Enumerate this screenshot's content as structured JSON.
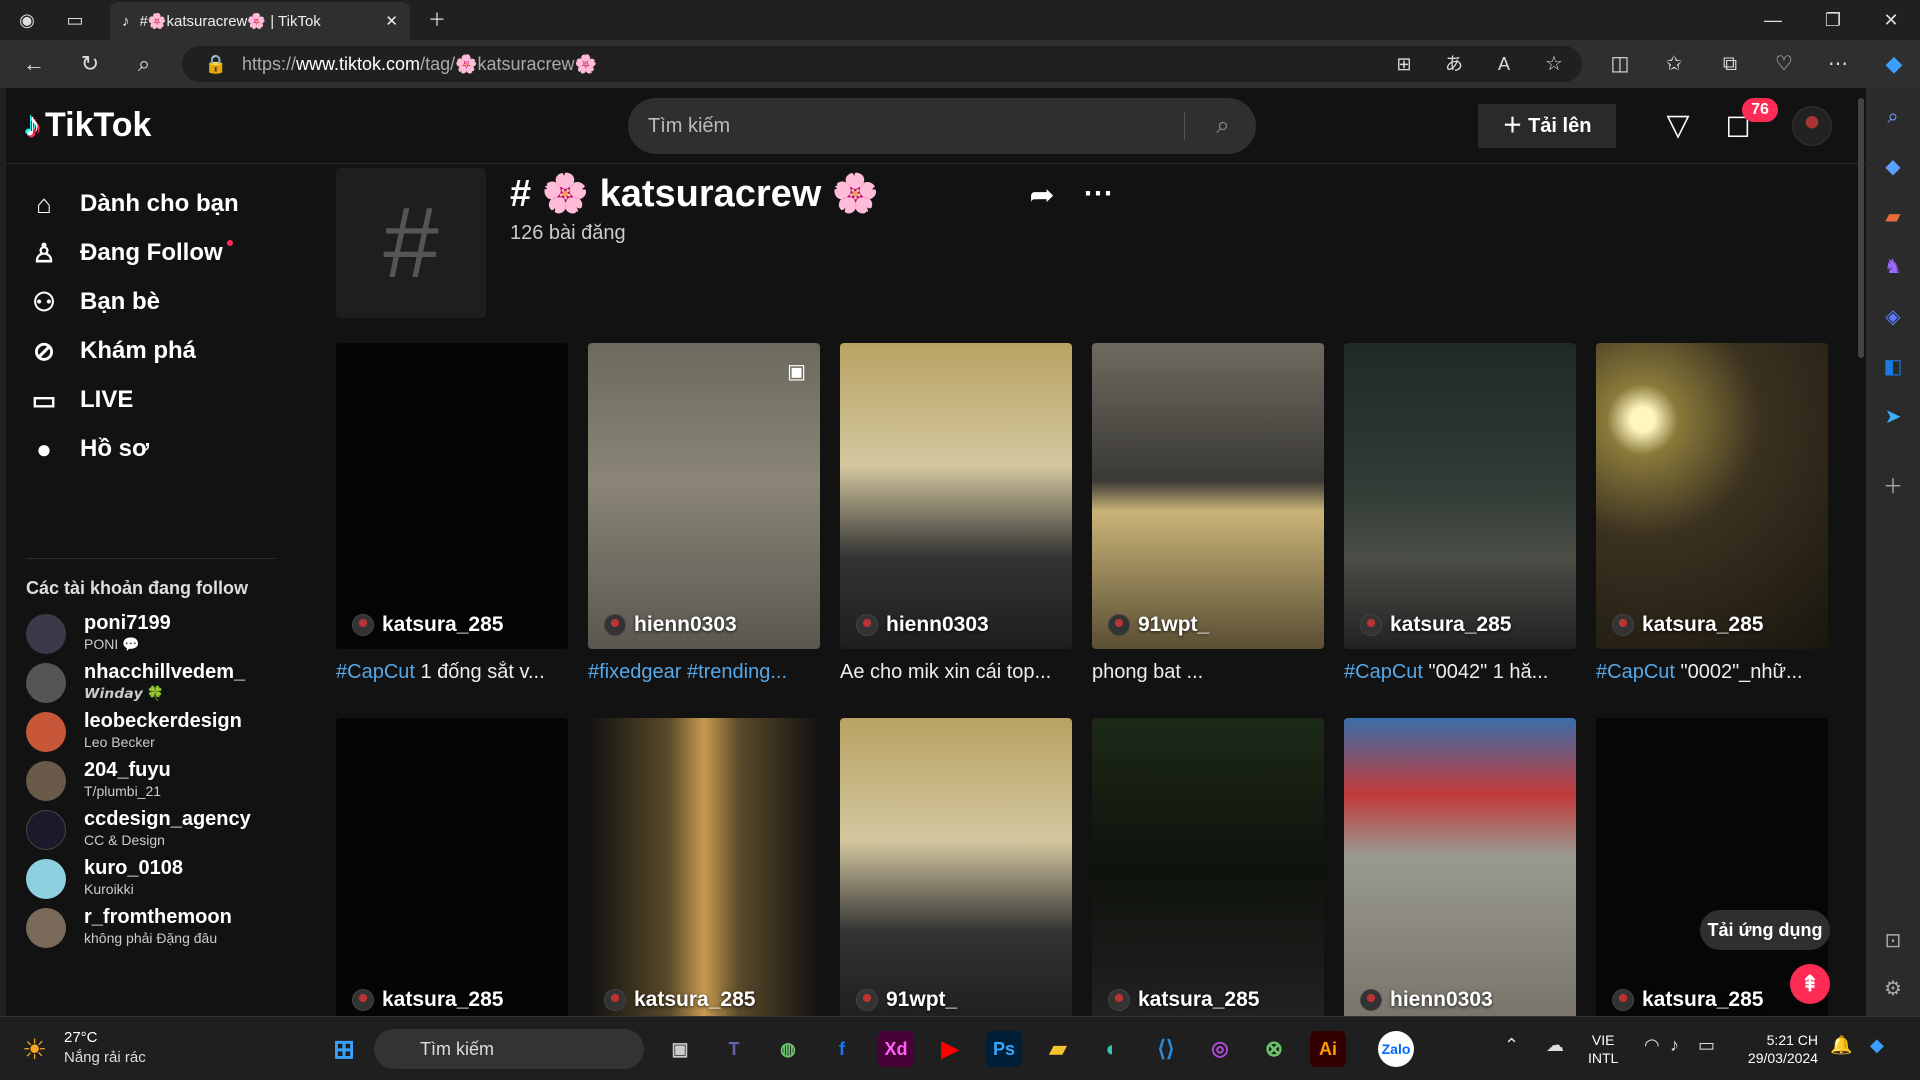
{
  "browser": {
    "tab_title": "#🌸katsuracrew🌸 | TikTok",
    "url_prefix": "https://",
    "url_host": "www.tiktok.com",
    "url_path": "/tag/🌸katsuracrew🌸"
  },
  "header": {
    "logo": "TikTok",
    "search_placeholder": "Tìm kiếm",
    "upload_label": "Tải lên",
    "inbox_badge": "76"
  },
  "nav": {
    "items": [
      {
        "label": "Dành cho bạn",
        "icon": "home-icon"
      },
      {
        "label": "Đang Follow",
        "icon": "following-icon"
      },
      {
        "label": "Bạn bè",
        "icon": "friends-icon"
      },
      {
        "label": "Khám phá",
        "icon": "compass-icon"
      },
      {
        "label": "LIVE",
        "icon": "live-icon"
      },
      {
        "label": "Hồ sơ",
        "icon": "profile-icon"
      }
    ],
    "following_title": "Các tài khoản đang follow",
    "accounts": [
      {
        "username": "poni7199",
        "nickname": "PONI 💬",
        "color": "#3a3a4a"
      },
      {
        "username": "nhacchillvedem_",
        "nickname": "𝙒𝙞𝙣𝙙𝙖𝙮 🍀",
        "color": "#555555"
      },
      {
        "username": "leobeckerdesign",
        "nickname": "Leo Becker",
        "color": "#c8573a"
      },
      {
        "username": "204_fuyu",
        "nickname": "T/plumbi_21",
        "color": "#6a5a4a"
      },
      {
        "username": "ccdesign_agency",
        "nickname": "CC & Design",
        "color": "#1a1a2a"
      },
      {
        "username": "kuro_0108",
        "nickname": "Kuroikki",
        "color": "#8fd0e0"
      },
      {
        "username": "r_fromthemoon",
        "nickname": "không phải Đặng đâu",
        "color": "#7a6a5a"
      }
    ]
  },
  "tag": {
    "symbol": "#",
    "title": "# 🌸 katsuracrew 🌸",
    "count": "126 bài đăng"
  },
  "videos": [
    {
      "user": "katsura_285",
      "tag": "#CapCut",
      "caption": " 1 đống sắt v...",
      "bg": "#050505"
    },
    {
      "user": "hienn0303",
      "tag": "#fixedgear #trending...",
      "caption": "",
      "bg": "linear-gradient(180deg,#6c6a5e 0%,#8a8576 45%,#5a5750 100%)"
    },
    {
      "user": "hienn0303",
      "tag": "",
      "caption": "Ae cho mik xin cái top...",
      "bg": "linear-gradient(180deg,#b8a262 0%,#d4c8a0 40%,#333 70%,#1e1e1e 100%)"
    },
    {
      "user": "91wpt_",
      "tag": "",
      "caption": "phong bat ...",
      "bg": "linear-gradient(180deg,#6f6a60 0%,#3a3935 45%,#c9b478 55%,#5a4e33 100%)"
    },
    {
      "user": "katsura_285",
      "tag": "#CapCut",
      "caption": " \"0042\" 1 hă...",
      "bg": "linear-gradient(180deg,#1f2a26 0%,#2f3b35 45%,#4a4e46 70%,#222 100%)"
    },
    {
      "user": "katsura_285",
      "tag": "#CapCut",
      "caption": " \"0002\"_nhữ...",
      "bg": "radial-gradient(circle at 20% 25%,#fff6c0 0 4%,#8a7a3a 12%,#3a3120 40%,#1a160e 100%)"
    },
    {
      "user": "katsura_285",
      "tag": "",
      "caption": "",
      "bg": "#050505"
    },
    {
      "user": "katsura_285",
      "tag": "",
      "caption": "",
      "bg": "linear-gradient(90deg,#111 0%,#5a4a2a 35%,#c79a50 50%,#5a4a2a 65%,#111 100%)"
    },
    {
      "user": "91wpt_",
      "tag": "",
      "caption": "",
      "bg": "linear-gradient(180deg,#b8a262 0%,#d4c8a0 40%,#333 70%,#1e1e1e 100%)"
    },
    {
      "user": "katsura_285",
      "tag": "",
      "caption": "",
      "bg": "linear-gradient(180deg,#1d2a18 0%,#0e120c 50%,#222 100%)"
    },
    {
      "user": "hienn0303",
      "tag": "",
      "caption": "",
      "bg": "linear-gradient(180deg,#3a6ea8 0%,#c23a3a 25%,#9a9a90 45%,#77736a 100%)"
    },
    {
      "user": "katsura_285",
      "tag": "",
      "caption": "",
      "bg": "#060606"
    }
  ],
  "floating": {
    "get_app": "Tải ứng dụng"
  },
  "taskbar": {
    "temp": "27°C",
    "weather": "Nắng rải rác",
    "search": "Tìm kiếm",
    "lang1": "VIE",
    "lang2": "INTL",
    "time": "5:21 CH",
    "date": "29/03/2024",
    "apps": [
      "Xd",
      "Ps",
      "Ai"
    ]
  }
}
